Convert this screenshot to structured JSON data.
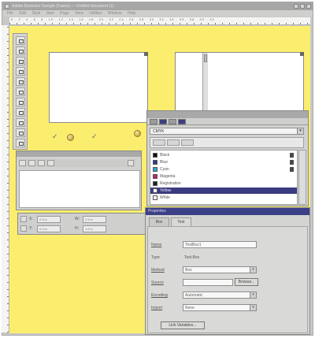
{
  "window": {
    "title": "Adobe Illustrator Sample (Frame) — Untitled document (1)",
    "minimize_glyph": "_",
    "maximize_glyph": "□",
    "close_glyph": "×"
  },
  "menubar": {
    "items": [
      "File",
      "Edit",
      "Style",
      "Item",
      "Page",
      "View",
      "Utilities",
      "Window",
      "Help"
    ]
  },
  "ruler": {
    "top_numbers": "0 . 2 . 4 . 6 . 8 . 10 . 12 . 14 . 16 . 18 . 20 . 22 . 24 . 26 . 28 . 30 . 32 . 34 . 36 . 38 . 40 . 42"
  },
  "colors_panel": {
    "model_value": "CMYK",
    "arrow_glyph": "▾",
    "colors": [
      {
        "name": "Black",
        "swatch": "#111111",
        "selected": false
      },
      {
        "name": "Blue",
        "swatch": "#2a3a9a",
        "selected": false
      },
      {
        "name": "Cyan",
        "swatch": "#2aa8d8",
        "selected": false
      },
      {
        "name": "Magenta",
        "swatch": "#c0207a",
        "selected": false
      },
      {
        "name": "Registration",
        "swatch": "#222222",
        "selected": false
      },
      {
        "name": "Yellow",
        "swatch": "#ffffff",
        "selected": true
      },
      {
        "name": "White",
        "swatch": "#ffffff",
        "selected": false
      }
    ]
  },
  "measurements": {
    "x_label": "X:",
    "y_label": "Y:",
    "w_label": "W:",
    "h_label": "H:",
    "x_value": "0.5 in",
    "y_value": "0.5 in",
    "w_value": "2.5 in",
    "h_value": "1.5 in"
  },
  "properties": {
    "title": "Properties",
    "tabs": [
      "Box",
      "Text"
    ],
    "name_label": "Name",
    "name_value": "TextBox1",
    "type_label": "Type",
    "type_value": "Text Box",
    "method_label": "Method",
    "method_value": "Box",
    "source_label": "Source",
    "source_value": "",
    "browse_label": "Browse...",
    "encoding_label": "Encoding",
    "encoding_value": "Automatic",
    "import_label": "Import",
    "import_value": "None",
    "apply_label": "Link Variables..."
  }
}
